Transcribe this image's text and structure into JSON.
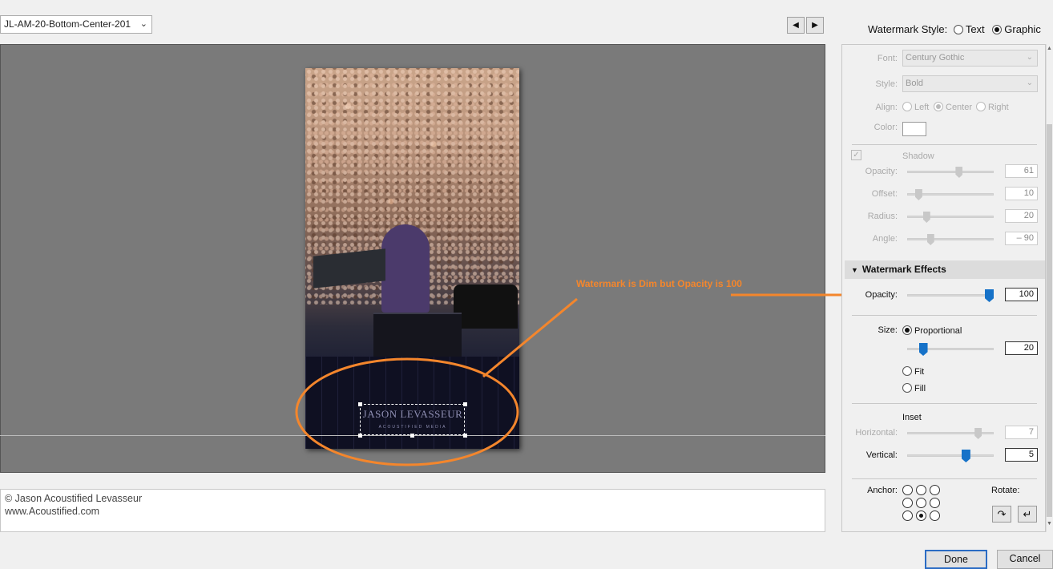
{
  "toolbar": {
    "preset_value": "JL-AM-20-Bottom-Center-201",
    "prev_icon": "triangle-left-icon",
    "next_icon": "triangle-right-icon"
  },
  "preview": {
    "watermark_text": "JASON LEVASSEUR",
    "watermark_sub": "ACOUSTIFIED MEDIA"
  },
  "annotation": {
    "text": "Watermark is Dim but Opacity is 100",
    "color": "#f4862c"
  },
  "caption": {
    "line1": "© Jason Acoustified Levasseur",
    "line2": "www.Acoustified.com"
  },
  "watermark_style": {
    "label": "Watermark Style:",
    "options": [
      "Text",
      "Graphic"
    ],
    "selected": "Graphic"
  },
  "text_options": {
    "font_label": "Font:",
    "font_value": "Century Gothic",
    "style_label": "Style:",
    "style_value": "Bold",
    "align_label": "Align:",
    "align_options": [
      "Left",
      "Center",
      "Right"
    ],
    "align_selected": "Center",
    "color_label": "Color:",
    "color_value": "#ffffff"
  },
  "shadow": {
    "label": "Shadow",
    "checked": true,
    "opacity_label": "Opacity:",
    "opacity_value": "61",
    "opacity_level": 0.61,
    "offset_label": "Offset:",
    "offset_value": "10",
    "offset_level": 0.1,
    "radius_label": "Radius:",
    "radius_value": "20",
    "radius_level": 0.2,
    "angle_label": "Angle:",
    "angle_value": "– 90",
    "angle_level": 0.25
  },
  "effects": {
    "header": "Watermark Effects",
    "opacity_label": "Opacity:",
    "opacity_value": "100",
    "opacity_level": 1.0,
    "size_label": "Size:",
    "size_options": [
      "Proportional",
      "Fit",
      "Fill"
    ],
    "size_selected": "Proportional",
    "size_value": "20",
    "size_level": 0.15,
    "inset_label": "Inset",
    "horizontal_label": "Horizontal:",
    "horizontal_value": "7",
    "horizontal_level": 0.85,
    "vertical_label": "Vertical:",
    "vertical_value": "5",
    "vertical_level": 0.7,
    "anchor_label": "Anchor:",
    "anchor_selected": "bottom-center",
    "rotate_label": "Rotate:",
    "rotate_cw_icon": "rotate-clockwise-icon",
    "rotate_ccw_icon": "rotate-counterclockwise-icon"
  },
  "footer": {
    "done_label": "Done",
    "cancel_label": "Cancel"
  },
  "colors": {
    "accent_blue": "#1672c8",
    "annotation_orange": "#f4862c"
  }
}
